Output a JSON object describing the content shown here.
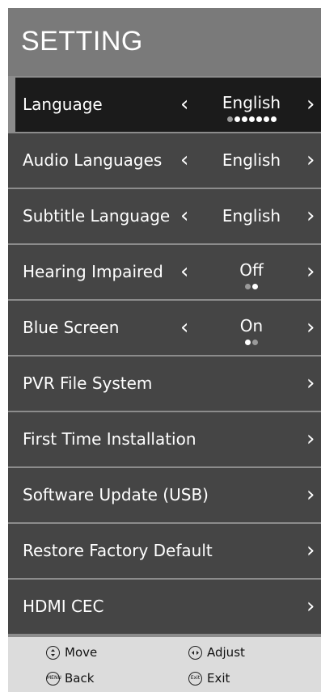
{
  "header": {
    "title": "SETTING"
  },
  "menu": [
    {
      "label": "Language",
      "value": "English",
      "has_value": true
    },
    {
      "label": "Audio Languages",
      "value": "English",
      "has_value": true
    },
    {
      "label": "Subtitle Language",
      "value": "English",
      "has_value": true
    },
    {
      "label": "Hearing Impaired",
      "value": "Off",
      "has_value": true
    },
    {
      "label": "Blue Screen",
      "value": "On",
      "has_value": true
    },
    {
      "label": "PVR File System",
      "has_value": false
    },
    {
      "label": "First Time Installation",
      "has_value": false
    },
    {
      "label": "Software Update (USB)",
      "has_value": false
    },
    {
      "label": "Restore Factory Default",
      "has_value": false
    },
    {
      "label": "HDMI CEC",
      "has_value": false
    }
  ],
  "footer": {
    "move": "Move",
    "adjust": "Adjust",
    "back": "Back",
    "exit": "Exit",
    "menu_icon_text": "MENU",
    "exit_icon_text": "Exit"
  },
  "colors": {
    "header": "#7a7a7a",
    "row": "#454545",
    "active_row": "#1b1b1b",
    "footer": "#dcdcdc"
  },
  "icons": [
    "chevron-left-icon",
    "chevron-right-icon",
    "updown-icon",
    "leftright-icon",
    "menu-button-icon",
    "exit-button-icon"
  ]
}
